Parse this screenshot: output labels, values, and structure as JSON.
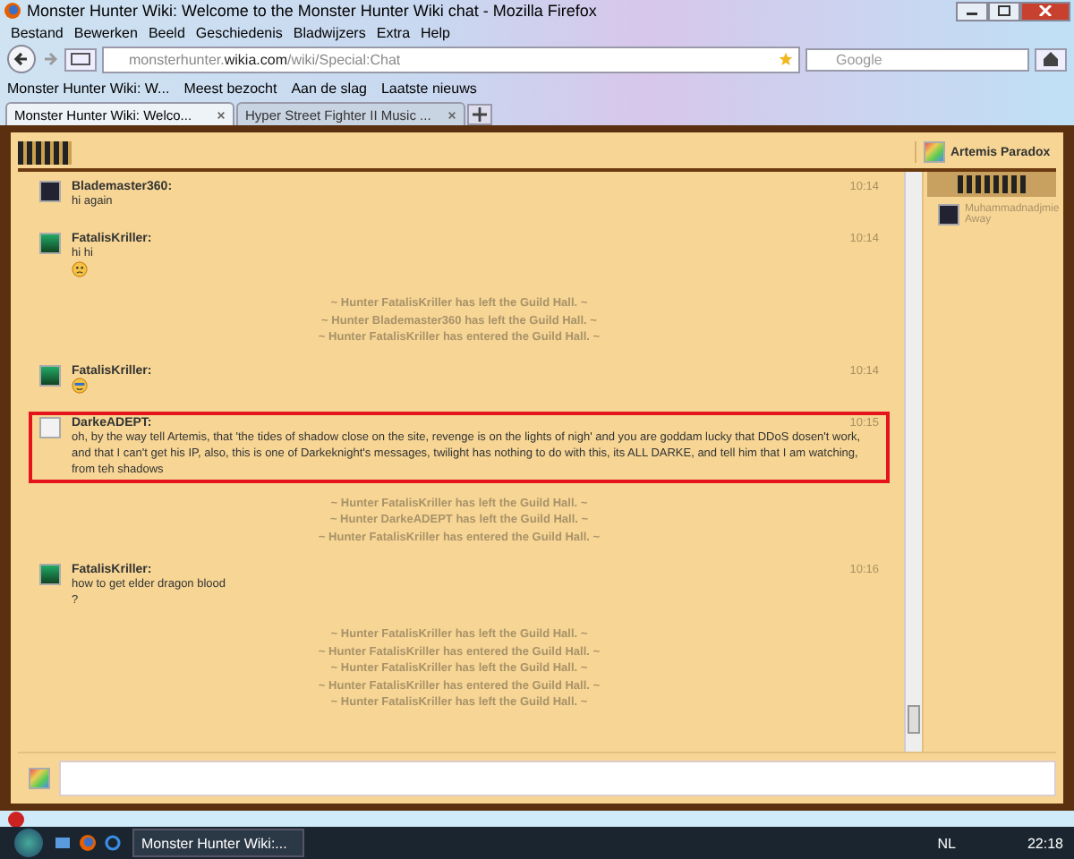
{
  "window": {
    "title": "Monster Hunter Wiki: Welcome to the Monster Hunter Wiki chat - Mozilla Firefox"
  },
  "menu": [
    "Bestand",
    "Bewerken",
    "Beeld",
    "Geschiedenis",
    "Bladwijzers",
    "Extra",
    "Help"
  ],
  "address_bar": {
    "value_host_pre": "monsterhunter.",
    "value_host": "wikia.com",
    "value_path": "/wiki/Special:Chat"
  },
  "search": {
    "placeholder": "Google"
  },
  "bookmarks": [
    "Monster Hunter Wiki: W...",
    "Meest bezocht",
    "Aan de slag",
    "Laatste nieuws"
  ],
  "tabs": [
    {
      "label": "Monster Hunter Wiki: Welco...",
      "selected": true
    },
    {
      "label": "Hyper Street Fighter II Music ...",
      "selected": false
    }
  ],
  "chat": {
    "user": "Artemis Paradox",
    "messages": [
      {
        "kind": "message",
        "avatar": {
          "kind": "dark"
        },
        "name": "Blademaster360:",
        "time": "10:14",
        "lines": [
          "hi again"
        ],
        "highlighted": false
      },
      {
        "kind": "message",
        "avatar": {
          "kind": "game"
        },
        "name": "FatalisKriller:",
        "time": "10:14",
        "lines": [
          "hi hi"
        ],
        "emoticon": {
          "kind": "frown"
        },
        "highlighted": false
      },
      {
        "kind": "system",
        "text": "~ Hunter FatalisKriller has left the Guild Hall. ~"
      },
      {
        "kind": "system",
        "text": "~ Hunter Blademaster360 has left the Guild Hall. ~"
      },
      {
        "kind": "system",
        "text": "~ Hunter FatalisKriller has entered the Guild Hall. ~"
      },
      {
        "kind": "message",
        "avatar": {
          "kind": "game"
        },
        "name": "FatalisKriller:",
        "time": "10:14",
        "emoticon": {
          "kind": "cool"
        },
        "highlighted": false
      },
      {
        "kind": "message",
        "avatar": {
          "kind": "blank"
        },
        "name": "DarkeADEPT:",
        "time": "10:15",
        "lines": [
          "oh, by the way tell Artemis, that 'the tides of shadow close on the site, revenge is on the lights of nigh' and you are goddam lucky that DDoS dosen't work, and that I can't get his IP, also, this is one of Darkeknight's messages, twilight has nothing to do with this, its ALL DARKE, and tell him that I am watching, from teh shadows"
        ],
        "highlighted": true
      },
      {
        "kind": "system",
        "text": "~ Hunter FatalisKriller has left the Guild Hall. ~"
      },
      {
        "kind": "system",
        "text": "~ Hunter DarkeADEPT has left the Guild Hall. ~"
      },
      {
        "kind": "system",
        "text": "~ Hunter FatalisKriller has entered the Guild Hall. ~"
      },
      {
        "kind": "message",
        "avatar": {
          "kind": "game"
        },
        "name": "FatalisKriller:",
        "time": "10:16",
        "lines": [
          "how to get elder dragon blood",
          "?"
        ],
        "highlighted": false
      },
      {
        "kind": "system",
        "text": "~ Hunter FatalisKriller has left the Guild Hall. ~"
      },
      {
        "kind": "system",
        "text": "~ Hunter FatalisKriller has entered the Guild Hall. ~"
      },
      {
        "kind": "system",
        "text": "~ Hunter FatalisKriller has left the Guild Hall. ~"
      },
      {
        "kind": "system",
        "text": "~ Hunter FatalisKriller has entered the Guild Hall. ~"
      },
      {
        "kind": "system",
        "text": "~ Hunter FatalisKriller has left the Guild Hall. ~"
      }
    ],
    "users": [
      {
        "name": "Muhammadnadjmie",
        "status": "Away"
      }
    ]
  },
  "taskbar": {
    "task": "Monster Hunter Wiki:...",
    "language": "NL",
    "clock": "22:18"
  }
}
